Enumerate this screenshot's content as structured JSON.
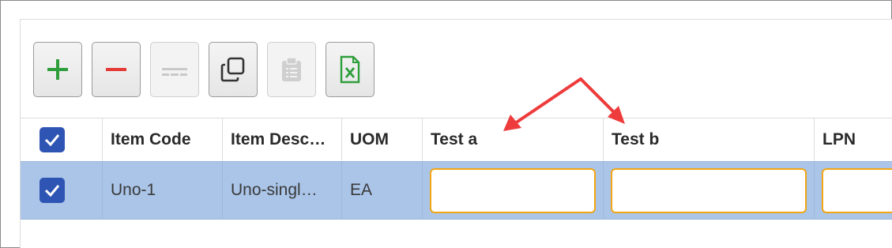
{
  "toolbar": {
    "buttons": [
      {
        "name": "add-row-button",
        "icon": "plus-icon",
        "color": "#2e9e3b",
        "enabled": true
      },
      {
        "name": "remove-row-button",
        "icon": "minus-icon",
        "color": "#e53935",
        "enabled": true
      },
      {
        "name": "clear-button",
        "icon": "dashes-icon",
        "color": "#c9c9c9",
        "enabled": false
      },
      {
        "name": "copy-button",
        "icon": "copy-icon",
        "color": "#333333",
        "enabled": true
      },
      {
        "name": "paste-button",
        "icon": "clipboard-icon",
        "color": "#c9c9c9",
        "enabled": false
      },
      {
        "name": "export-excel-button",
        "icon": "excel-file-icon",
        "color": "#2e9e3b",
        "enabled": true
      }
    ]
  },
  "table": {
    "columns": [
      "Item Code",
      "Item Desc…",
      "UOM",
      "Test a",
      "Test b",
      "LPN"
    ],
    "rows": [
      {
        "selected": true,
        "item_code": "Uno-1",
        "item_desc": "Uno-singl…",
        "uom": "EA",
        "test_a": "",
        "test_b": "",
        "lpn": ""
      }
    ]
  },
  "colors": {
    "selected_row": "#aac5e8",
    "checkbox": "#2f55b4",
    "editable_border": "#f2a516",
    "annotation_arrow": "#ee3b3b"
  }
}
